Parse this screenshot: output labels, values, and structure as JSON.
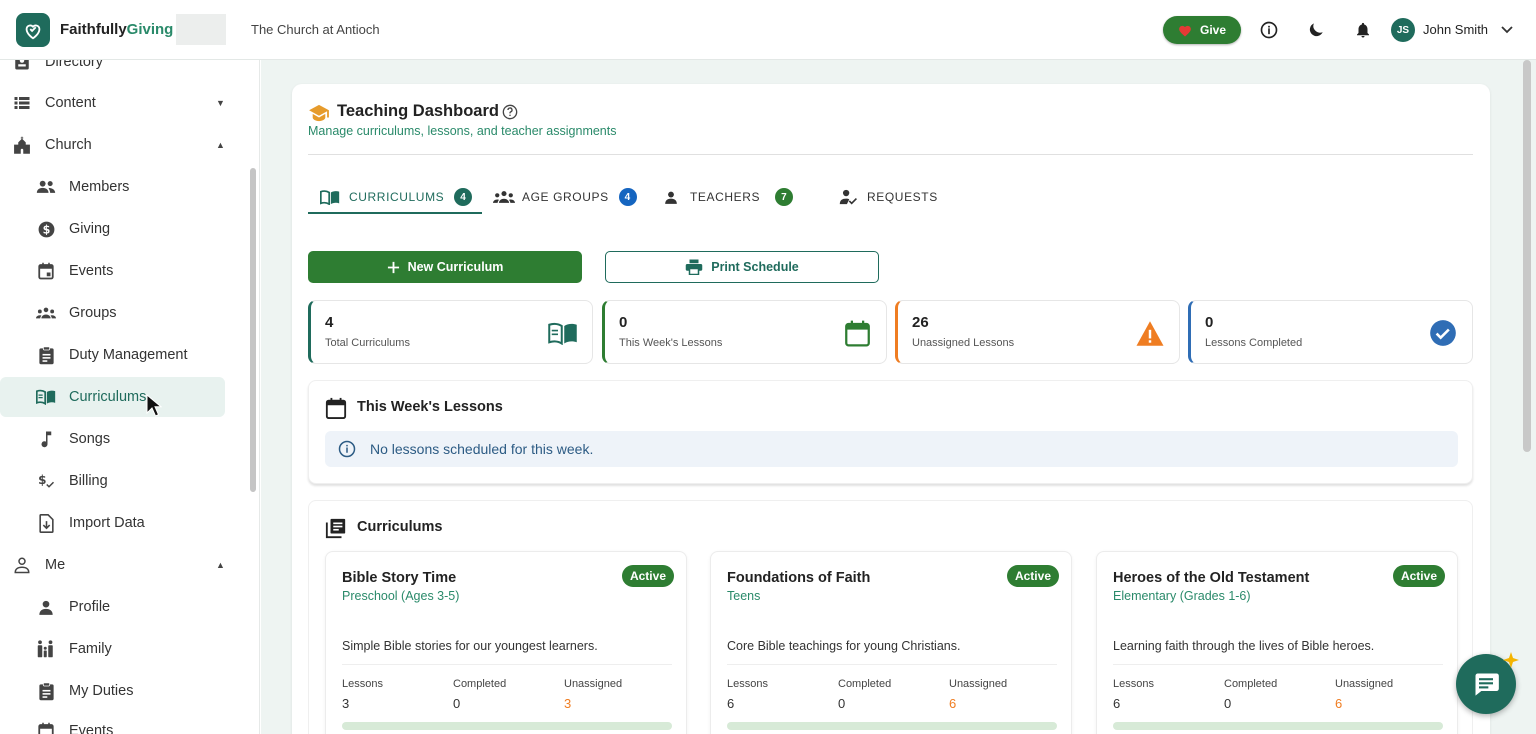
{
  "topbar": {
    "brand_part1": "Faithfully",
    "brand_part2": "Giving",
    "church_name": "The Church at Antioch",
    "give_label": "Give",
    "user_initials": "JS",
    "user_name": "John Smith"
  },
  "sidebar": {
    "items": [
      {
        "label": "Directory",
        "icon": "directory-icon"
      },
      {
        "label": "Content",
        "icon": "list-icon"
      },
      {
        "label": "Church",
        "icon": "church-icon"
      },
      {
        "label": "Members",
        "icon": "members-icon"
      },
      {
        "label": "Giving",
        "icon": "dollar-icon"
      },
      {
        "label": "Events",
        "icon": "calendar-icon"
      },
      {
        "label": "Groups",
        "icon": "groups-icon"
      },
      {
        "label": "Duty Management",
        "icon": "clipboard-icon"
      },
      {
        "label": "Curriculums",
        "icon": "book-icon"
      },
      {
        "label": "Songs",
        "icon": "music-note-icon"
      },
      {
        "label": "Billing",
        "icon": "billing-icon"
      },
      {
        "label": "Import Data",
        "icon": "import-icon"
      },
      {
        "label": "Me",
        "icon": "person-icon"
      },
      {
        "label": "Profile",
        "icon": "profile-icon"
      },
      {
        "label": "Family",
        "icon": "family-icon"
      },
      {
        "label": "My Duties",
        "icon": "clipboard-icon"
      },
      {
        "label": "Events",
        "icon": "calendar-icon"
      }
    ]
  },
  "header": {
    "title": "Teaching Dashboard",
    "subtitle": "Manage curriculums, lessons, and teacher assignments"
  },
  "tabs": [
    {
      "label": "CURRICULUMS",
      "count": "4"
    },
    {
      "label": "AGE GROUPS",
      "count": "4"
    },
    {
      "label": "TEACHERS",
      "count": "7"
    },
    {
      "label": "REQUESTS",
      "count": ""
    }
  ],
  "actions": {
    "new_curriculum": "New Curriculum",
    "print_schedule": "Print Schedule"
  },
  "stats": [
    {
      "value": "4",
      "label": "Total Curriculums",
      "color": "#1f6b5c"
    },
    {
      "value": "0",
      "label": "This Week's Lessons",
      "color": "#2e7d32"
    },
    {
      "value": "26",
      "label": "Unassigned Lessons",
      "color": "#ef7d22"
    },
    {
      "value": "0",
      "label": "Lessons Completed",
      "color": "#2f6db5"
    }
  ],
  "week": {
    "title": "This Week's Lessons",
    "empty_message": "No lessons scheduled for this week."
  },
  "curriculums": {
    "title": "Curriculums",
    "col_lessons": "Lessons",
    "col_completed": "Completed",
    "col_unassigned": "Unassigned",
    "items": [
      {
        "name": "Bible Story Time",
        "age_group": "Preschool (Ages 3-5)",
        "status": "Active",
        "description": "Simple Bible stories for our youngest learners.",
        "lessons": "3",
        "completed": "0",
        "unassigned": "3",
        "progress": 0
      },
      {
        "name": "Foundations of Faith",
        "age_group": "Teens",
        "status": "Active",
        "description": "Core Bible teachings for young Christians.",
        "lessons": "6",
        "completed": "0",
        "unassigned": "6",
        "progress": 0
      },
      {
        "name": "Heroes of the Old Testament",
        "age_group": "Elementary (Grades 1-6)",
        "status": "Active",
        "description": "Learning faith through the lives of Bible heroes.",
        "lessons": "6",
        "completed": "0",
        "unassigned": "6",
        "progress": 0
      }
    ]
  },
  "colors": {
    "brand": "#1f6b5c",
    "primary_button": "#2e7d32",
    "warning": "#ef7d22",
    "info": "#2f6db5"
  }
}
